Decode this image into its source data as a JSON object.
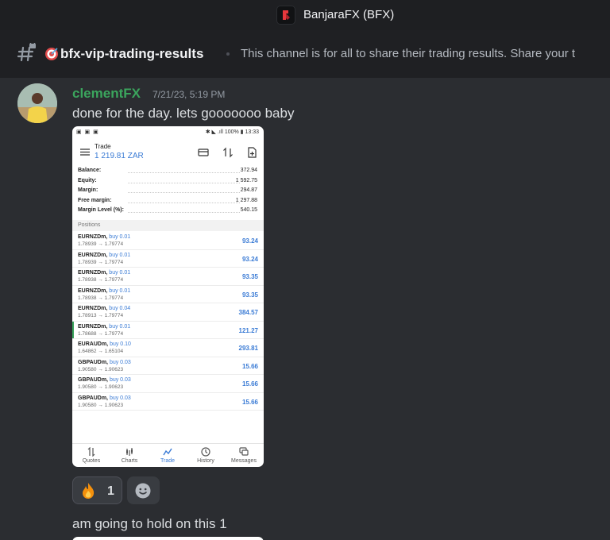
{
  "app": {
    "title": "BanjaraFX (BFX)",
    "logo_icon": "banjarafx-logo-icon"
  },
  "channel": {
    "icon": "hash-lock-icon",
    "emoji": "target-icon",
    "name": "bfx-vip-trading-results",
    "topic": "This channel is for all to share their trading results. Share your t"
  },
  "message": {
    "author": "clementFX",
    "author_color": "#3ba55d",
    "timestamp": "7/21/23, 5:19 PM",
    "text": "done for the day. lets gooooooo baby",
    "followup_text": "am going to hold on this 1",
    "reactions": [
      {
        "emoji": "fire-icon",
        "count": "1"
      },
      {
        "emoji": "add-reaction-icon"
      }
    ]
  },
  "attachment": {
    "status": {
      "left": "▣ ▣ ▣",
      "right": "✱ ◣ .ıll 100% ▮ 13:33"
    },
    "header": {
      "title": "Trade",
      "balance": "1 219.81 ZAR"
    },
    "summary": [
      {
        "label": "Balance:",
        "value": "372.94"
      },
      {
        "label": "Equity:",
        "value": "1 592.75"
      },
      {
        "label": "Margin:",
        "value": "294.87"
      },
      {
        "label": "Free margin:",
        "value": "1 297.88"
      },
      {
        "label": "Margin Level (%):",
        "value": "540.15"
      }
    ],
    "positions_label": "Positions",
    "positions": [
      {
        "symbol": "EURNZDm,",
        "side": "buy 0.01",
        "prices": "1.78939 → 1.79774",
        "profit": "93.24"
      },
      {
        "symbol": "EURNZDm,",
        "side": "buy 0.01",
        "prices": "1.78939 → 1.79774",
        "profit": "93.24"
      },
      {
        "symbol": "EURNZDm,",
        "side": "buy 0.01",
        "prices": "1.78938 → 1.79774",
        "profit": "93.35"
      },
      {
        "symbol": "EURNZDm,",
        "side": "buy 0.01",
        "prices": "1.78938 → 1.79774",
        "profit": "93.35"
      },
      {
        "symbol": "EURNZDm,",
        "side": "buy 0.04",
        "prices": "1.78913 → 1.79774",
        "profit": "384.57"
      },
      {
        "symbol": "EURNZDm,",
        "side": "buy 0.01",
        "prices": "1.78688 → 1.79774",
        "profit": "121.27"
      },
      {
        "symbol": "EURAUDm,",
        "side": "buy 0.10",
        "prices": "1.64862 → 1.65104",
        "profit": "293.81"
      },
      {
        "symbol": "GBPAUDm,",
        "side": "buy 0.03",
        "prices": "1.90580 → 1.90623",
        "profit": "15.66"
      },
      {
        "symbol": "GBPAUDm,",
        "side": "buy 0.03",
        "prices": "1.90580 → 1.90623",
        "profit": "15.66"
      },
      {
        "symbol": "GBPAUDm,",
        "side": "buy 0.03",
        "prices": "1.90580 → 1.90623",
        "profit": "15.66"
      }
    ],
    "nav": [
      {
        "label": "Quotes",
        "icon": "quotes-icon"
      },
      {
        "label": "Charts",
        "icon": "charts-icon"
      },
      {
        "label": "Trade",
        "icon": "trade-icon"
      },
      {
        "label": "History",
        "icon": "history-icon"
      },
      {
        "label": "Messages",
        "icon": "messages-icon"
      }
    ]
  }
}
